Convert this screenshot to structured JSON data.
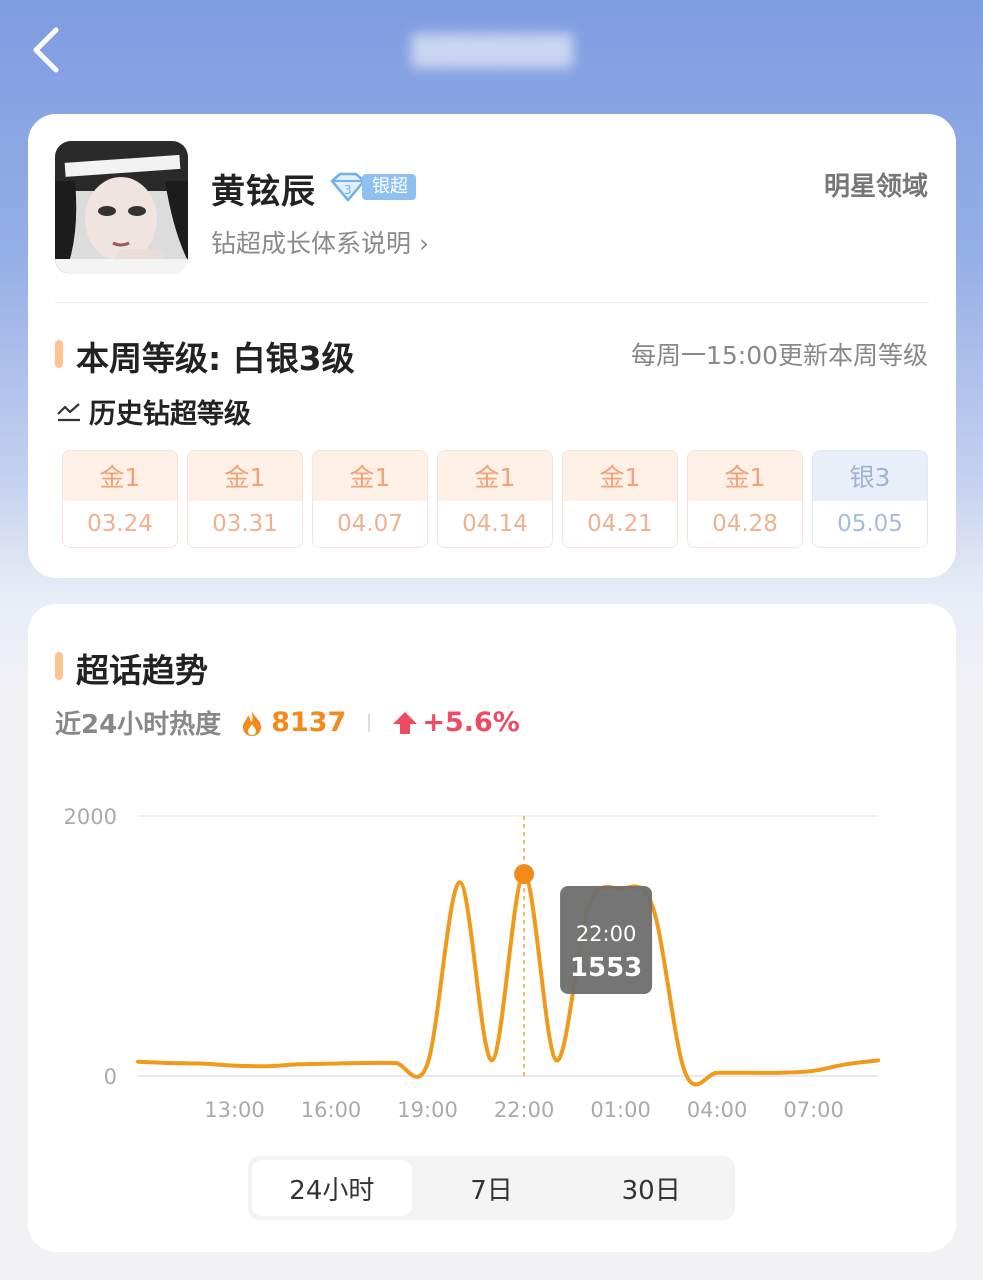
{
  "header": {
    "back_icon": "chevron-left-icon",
    "blurred_title": "▓▓▓▓▓▓▓"
  },
  "profile": {
    "name": "黄铉辰",
    "level_badge": "银超",
    "growth_link": "钻超成长体系说明 ›",
    "domain_label": "明星领域",
    "week_level": "本周等级: 白银3级",
    "update_note": "每周一15:00更新本周等级",
    "history_label": "历史钻超等级",
    "history": [
      {
        "grade": "金1",
        "date": "03.24",
        "tier": "gold"
      },
      {
        "grade": "金1",
        "date": "03.31",
        "tier": "gold"
      },
      {
        "grade": "金1",
        "date": "04.07",
        "tier": "gold"
      },
      {
        "grade": "金1",
        "date": "04.14",
        "tier": "gold"
      },
      {
        "grade": "金1",
        "date": "04.21",
        "tier": "gold"
      },
      {
        "grade": "金1",
        "date": "04.28",
        "tier": "gold"
      },
      {
        "grade": "银3",
        "date": "05.05",
        "tier": "silver"
      }
    ]
  },
  "trend": {
    "title": "超话趋势",
    "heat_label": "近24小时热度",
    "heat_value": "8137",
    "heat_change": "+5.6%",
    "tooltip_time": "22:00",
    "tooltip_value": "1553",
    "tabs": [
      "24小时",
      "7日",
      "30日"
    ],
    "active_tab": 0
  },
  "colors": {
    "line": "#f09a1c",
    "accent": "#ffc392",
    "up": "#ef4a64"
  },
  "chart_data": {
    "type": "line",
    "x_ticks": [
      "13:00",
      "16:00",
      "19:00",
      "22:00",
      "01:00",
      "04:00",
      "07:00"
    ],
    "y_ticks": [
      "0",
      "2000"
    ],
    "ylim": [
      0,
      2000
    ],
    "x": [
      "10:00",
      "11:00",
      "12:00",
      "13:00",
      "14:00",
      "15:00",
      "16:00",
      "17:00",
      "18:00",
      "19:00",
      "20:00",
      "21:00",
      "22:00",
      "23:00",
      "00:00",
      "01:00",
      "02:00",
      "03:00",
      "04:00",
      "05:00",
      "06:00",
      "07:00",
      "08:00",
      "09:00"
    ],
    "values": [
      110,
      100,
      95,
      80,
      75,
      90,
      95,
      100,
      100,
      95,
      1490,
      120,
      1553,
      120,
      1300,
      1440,
      1300,
      30,
      25,
      25,
      25,
      40,
      90,
      120
    ],
    "highlight": {
      "x": "22:00",
      "value": 1553
    },
    "grid": true
  }
}
